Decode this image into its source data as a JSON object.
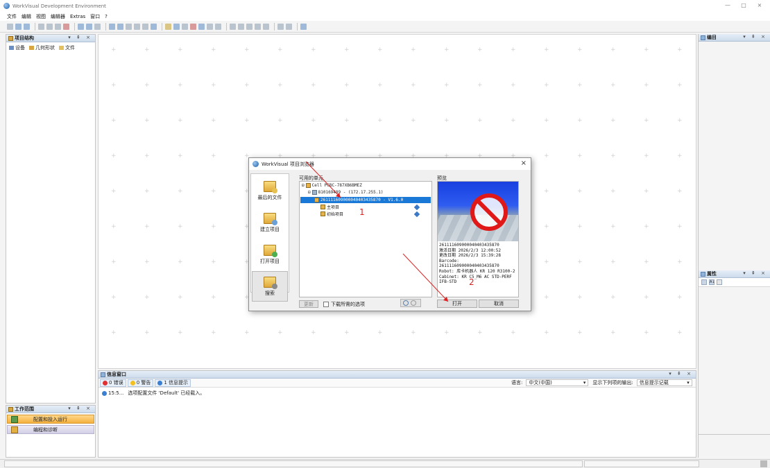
{
  "window": {
    "title": "WorkVisual Development Environment",
    "controls": [
      "—",
      "□",
      "×"
    ]
  },
  "menu": [
    "文件",
    "编辑",
    "视图",
    "编辑器",
    "Extras",
    "窗口",
    "?"
  ],
  "left_panel": {
    "title": "项目结构",
    "controls": "▾ ⇞ ×",
    "tabs": [
      "设备",
      "几何形状",
      "文件"
    ]
  },
  "right_top_panel": {
    "title": "编目",
    "controls": "▾ ⇞ ×"
  },
  "right_bot_panel": {
    "title": "属性",
    "controls": "▾ ⇞ ×",
    "tool_label": "A↓"
  },
  "info_panel": {
    "title": "信息窗口",
    "controls": "▾ ⇞ ×",
    "filters": [
      {
        "label": "0 错误",
        "color": "#e03030"
      },
      {
        "label": "0 警告",
        "color": "#f2c020"
      },
      {
        "label": "1 信息提示",
        "color": "#3a7fd0"
      }
    ],
    "language_label": "语言:",
    "language_value": "中文(中国)",
    "output_label": "显示下列项的输出:",
    "output_value": "信息提示记载",
    "messages": [
      {
        "time": "15:5...",
        "text": "选项配置文件 'Default' 已经载入。"
      }
    ]
  },
  "work_panel": {
    "title": "工作范围",
    "controls": "▾ ⇞ ×",
    "items": [
      {
        "label": "配置和投入运行",
        "active": true
      },
      {
        "label": "编程和诊断",
        "active": false
      }
    ]
  },
  "dialog": {
    "title": "WorkVisual 项目浏览器",
    "close": "×",
    "side_buttons": [
      "最后的文件",
      "建立项目",
      "打开项目",
      "搜索"
    ],
    "tree_label": "可用的单元",
    "tree": [
      "Cell PCBC-787XB6BMEZ",
      "810169489 - (172.17.255.1)",
      "261111609000040403435870 - V1.6.0",
      "主项目",
      "初始项目"
    ],
    "update_button": "更新",
    "download_checkbox": "下载所需的选项",
    "preview_label": "预览",
    "preview_info": [
      "261111609000040403435870",
      "激活日期 2026/2/3 12:00:52",
      "更改日期 2026/2/3 15:39:28",
      "Barcode:",
      "261111609000040403435870",
      "Robot: 库卡机器人 KR 120 R3100-2",
      "Cabinet: KR C5_M6 AC STD-PERF",
      "IFB-STD"
    ],
    "open_button": "打开",
    "cancel_button": "取消"
  },
  "annotations": {
    "label_1": "1",
    "label_2": "2",
    "color": "#e02020"
  }
}
